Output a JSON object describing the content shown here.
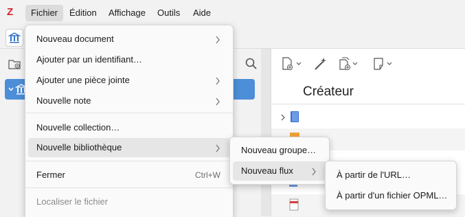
{
  "menubar": {
    "logo": "Z",
    "items": [
      "Fichier",
      "Édition",
      "Affichage",
      "Outils",
      "Aide"
    ]
  },
  "file_menu": {
    "items": [
      {
        "label": "Nouveau document",
        "submenu": true
      },
      {
        "label": "Ajouter par un identifiant…"
      },
      {
        "label": "Ajouter une pièce jointe",
        "submenu": true
      },
      {
        "label": "Nouvelle note",
        "submenu": true
      },
      {
        "label": "Nouvelle collection…"
      },
      {
        "label": "Nouvelle bibliothèque",
        "submenu": true,
        "highlighted": true
      },
      {
        "label": "Fermer",
        "shortcut": "Ctrl+W"
      },
      {
        "label": "Localiser le fichier",
        "disabled": true
      }
    ]
  },
  "library_submenu": {
    "items": [
      {
        "label": "Nouveau groupe…"
      },
      {
        "label": "Nouveau flux",
        "submenu": true,
        "highlighted": true
      }
    ]
  },
  "feed_submenu": {
    "items": [
      {
        "label": "À partir de l'URL…"
      },
      {
        "label": "À partir d'un fichier OPML…"
      }
    ]
  },
  "items_pane": {
    "column_header": "Créateur"
  },
  "colors": {
    "selection": "#4d8ed8",
    "logo": "#d3232f",
    "highlight": "#e6e6e6"
  }
}
